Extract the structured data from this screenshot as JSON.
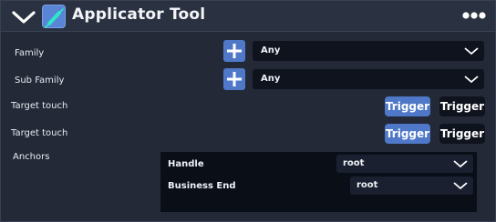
{
  "header": {
    "title": "Applicator Tool",
    "collapse_icon": "chevron-down-icon",
    "tool_icon": "syringe-icon",
    "more_icon": "more-dots-icon"
  },
  "fields": {
    "family": {
      "label": "Family",
      "value": "Any"
    },
    "sub_family": {
      "label": "Sub Family",
      "value": "Any"
    },
    "target_touch_1": {
      "label": "Target touch",
      "option_active": "Trigger",
      "option_inactive": "Trigger"
    },
    "target_touch_2": {
      "label": "Target touch",
      "option_active": "Trigger",
      "option_inactive": "Trigger"
    },
    "anchors": {
      "label": "Anchors",
      "handle": {
        "label": "Handle",
        "value": "root"
      },
      "business_end": {
        "label": "Business End",
        "value": "root"
      }
    }
  },
  "colors": {
    "panel_bg": "#232937",
    "accent": "#4f78c8",
    "field_bg": "#0f131d"
  }
}
